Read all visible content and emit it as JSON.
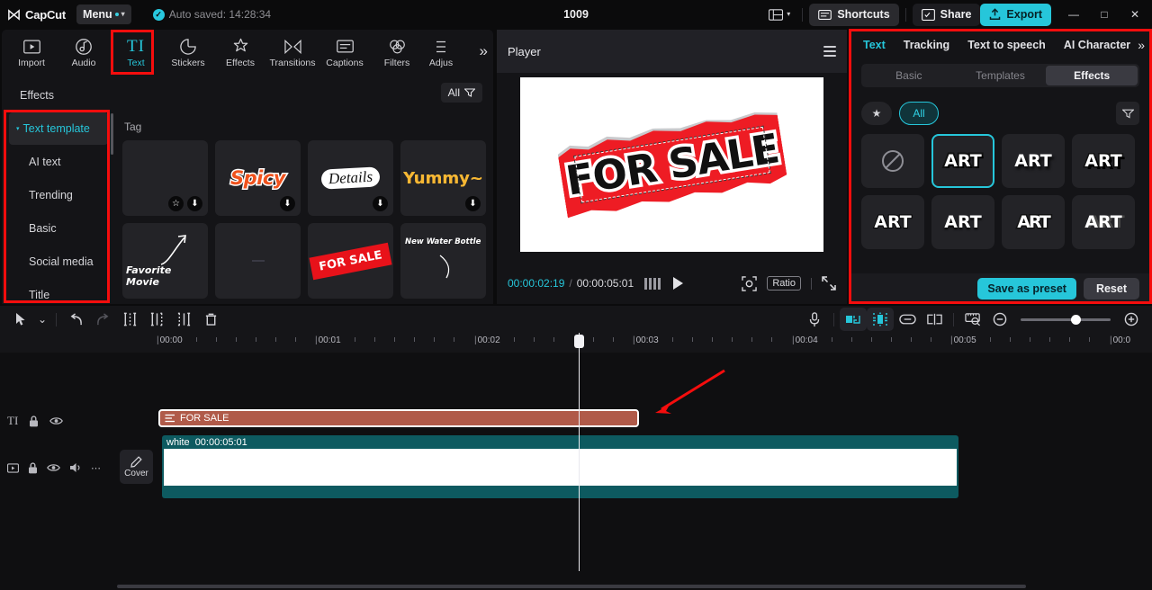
{
  "app": {
    "name": "CapCut",
    "project_title": "1009"
  },
  "topbar": {
    "menu_label": "Menu",
    "autosave_text": "Auto saved: 14:28:34",
    "shortcuts_label": "Shortcuts",
    "share_label": "Share",
    "export_label": "Export",
    "layout_icon": "layout-icon",
    "minimize_glyph": "—",
    "maximize_glyph": "□",
    "close_glyph": "✕",
    "accent_color": "#26c6da"
  },
  "function_bar": {
    "items": [
      {
        "label": "Import",
        "icon": "import-icon",
        "active": false
      },
      {
        "label": "Audio",
        "icon": "audio-icon",
        "active": false
      },
      {
        "label": "Text",
        "icon": "text-icon",
        "active": true
      },
      {
        "label": "Stickers",
        "icon": "stickers-icon",
        "active": false
      },
      {
        "label": "Effects",
        "icon": "effects-icon",
        "active": false
      },
      {
        "label": "Transitions",
        "icon": "transitions-icon",
        "active": false
      },
      {
        "label": "Captions",
        "icon": "captions-icon",
        "active": false
      },
      {
        "label": "Filters",
        "icon": "filters-icon",
        "active": false
      },
      {
        "label": "Adjus",
        "icon": "adjust-icon",
        "active": false
      }
    ],
    "expand_glyph": "»"
  },
  "sidebar": {
    "items": [
      {
        "label": "Effects",
        "active": false,
        "sub": false,
        "caret": ""
      },
      {
        "label": "Text template",
        "active": true,
        "sub": false,
        "caret": "▾"
      },
      {
        "label": "AI text",
        "active": false,
        "sub": true,
        "caret": ""
      },
      {
        "label": "Trending",
        "active": false,
        "sub": true,
        "caret": ""
      },
      {
        "label": "Basic",
        "active": false,
        "sub": true,
        "caret": ""
      },
      {
        "label": "Social media",
        "active": false,
        "sub": true,
        "caret": ""
      },
      {
        "label": "Title",
        "active": false,
        "sub": true,
        "caret": ""
      }
    ]
  },
  "template_panel": {
    "filter_label": "All",
    "filter_icon": "filter-icon",
    "section_label": "Tag",
    "download_glyph": "⬇",
    "star_glyph": "☆",
    "items": [
      {
        "kind": "blank",
        "text": "",
        "badges": [
          "star",
          "download"
        ]
      },
      {
        "kind": "spicy",
        "text": "Spicy",
        "badges": [
          "download"
        ]
      },
      {
        "kind": "details",
        "text": "Details",
        "badges": [
          "download"
        ]
      },
      {
        "kind": "yummy",
        "text": "Yummy~",
        "badges": [
          "download"
        ]
      },
      {
        "kind": "favorite",
        "text": "Favorite Movie",
        "badges": []
      },
      {
        "kind": "dash",
        "text": "",
        "badges": []
      },
      {
        "kind": "forsale",
        "text": "FOR SALE",
        "badges": []
      },
      {
        "kind": "waterbottle",
        "text": "New Water Bottle",
        "badges": []
      }
    ]
  },
  "player": {
    "title": "Player",
    "menu_icon": "hamburger-icon",
    "current_time": "00:00:02:19",
    "separator": "/",
    "total_time": "00:00:05:01",
    "frame_icon": "frames-icon",
    "play_icon": "play-icon",
    "crop_icon": "crop-icon",
    "ratio_label": "Ratio",
    "fullscreen_icon": "fullscreen-icon",
    "canvas_text": "FOR SALE"
  },
  "right_panel": {
    "tabs": [
      {
        "label": "Text",
        "active": true
      },
      {
        "label": "Tracking",
        "active": false
      },
      {
        "label": "Text to speech",
        "active": false
      },
      {
        "label": "AI Character",
        "active": false
      }
    ],
    "more_glyph": "»",
    "segments": [
      {
        "label": "Basic",
        "active": false
      },
      {
        "label": "Templates",
        "active": false
      },
      {
        "label": "Effects",
        "active": true
      }
    ],
    "star_glyph": "★",
    "all_label": "All",
    "filter_icon": "filter-icon",
    "effects": [
      {
        "label": "",
        "kind": "none",
        "active": false
      },
      {
        "label": "ART",
        "kind": "s1",
        "active": true
      },
      {
        "label": "ART",
        "kind": "s2",
        "active": false
      },
      {
        "label": "ART",
        "kind": "s3",
        "active": false
      },
      {
        "label": "ART",
        "kind": "s4",
        "active": false
      },
      {
        "label": "ART",
        "kind": "s5",
        "active": false
      },
      {
        "label": "ART",
        "kind": "s6",
        "active": false
      },
      {
        "label": "ART",
        "kind": "s7",
        "active": false
      }
    ],
    "save_preset_label": "Save as preset",
    "reset_label": "Reset"
  },
  "timeline_toolbar": {
    "select_icon": "cursor-icon",
    "dropdown_glyph": "⌄",
    "undo_icon": "undo-icon",
    "redo_icon": "redo-icon",
    "split_icon": "split-icon",
    "trim_left_icon": "trim-left-icon",
    "trim_right_icon": "trim-right-icon",
    "delete_icon": "delete-icon",
    "mic_icon": "microphone-icon",
    "snap_icon": "snap-icon",
    "magnet_icon": "magnet-icon",
    "link_icon": "link-icon",
    "unlink_icon": "unlink-icon",
    "preview_icon": "preview-ruler-icon",
    "zoom_out_icon": "zoom-out-icon",
    "zoom_in_icon": "zoom-in-icon"
  },
  "timeline": {
    "ruler_ticks": [
      "00:00",
      "00:01",
      "00:02",
      "00:03",
      "00:04",
      "00:05",
      "00:0"
    ],
    "text_track": {
      "head_icons": [
        "TI",
        "lock-icon",
        "eye-icon"
      ],
      "clip_label": "FOR SALE",
      "clip_icon": "text-clip-icon"
    },
    "video_track": {
      "head_icons": [
        "video-icon",
        "lock-icon",
        "eye-icon",
        "volume-icon",
        "more-icon"
      ],
      "cover_label": "Cover",
      "clip_name": "white",
      "clip_duration": "00:00:05:01"
    }
  }
}
